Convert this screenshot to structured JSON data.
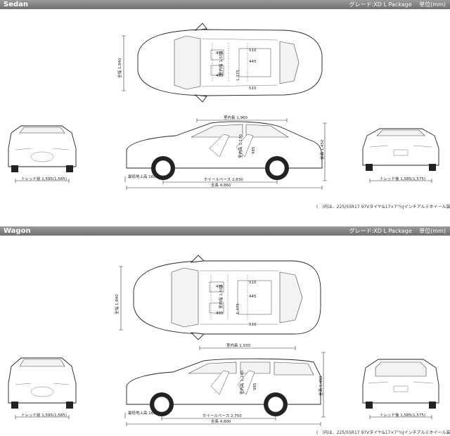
{
  "sedan": {
    "title": "Sedan",
    "grade": "グレード:XD L Package",
    "unit": "単位(mm)",
    "dims": {
      "overall_width": "全幅 1,840",
      "interior_width_v": "室内幅 1,550",
      "front_room": "495",
      "rear_room": "495",
      "seat_top": "510",
      "seat_mid": "445",
      "seat_low": "510",
      "width_1375": "1,375",
      "interior_length": "室内長 1,960",
      "interior_height": "室内高 1,170",
      "seat_h": "985",
      "overall_height": "全高 1,450",
      "front_tread": "トレッド前 1,595(1,585)",
      "rear_tread": "トレッド後 1,585(1,575)",
      "ground_clearance": "最低地上高 160",
      "wheelbase": "ホイールベース 2,830",
      "overall_length": "全長 4,860"
    },
    "note": "(　)内は、225/55R17 97Vタイヤ&17×7\"½Jインチアルミホイール装着車"
  },
  "wagon": {
    "title": "Wagon",
    "grade": "グレード:XD L Package",
    "unit": "単位(mm)",
    "dims": {
      "overall_width": "全幅 1,840",
      "interior_width_v": "室内幅 1,550",
      "front_room": "495",
      "rear_room": "495",
      "seat_top": "510",
      "seat_mid": "445",
      "seat_low": "510",
      "width_1375": "1,375",
      "interior_length": "室内長 1,930",
      "interior_height": "室内高 1,180",
      "seat_h": "985",
      "overall_height": "全高 1,480",
      "front_tread": "トレッド前 1,595(1,585)",
      "rear_tread": "トレッド後 1,585(1,575)",
      "ground_clearance": "最低地上高 160",
      "wheelbase": "ホイールベース 2,750",
      "overall_length": "全長 4,800"
    },
    "note": "(　)内は、225/55R17 97Vタイヤ&17×7\"½Jインチアルミホイール装着車"
  }
}
